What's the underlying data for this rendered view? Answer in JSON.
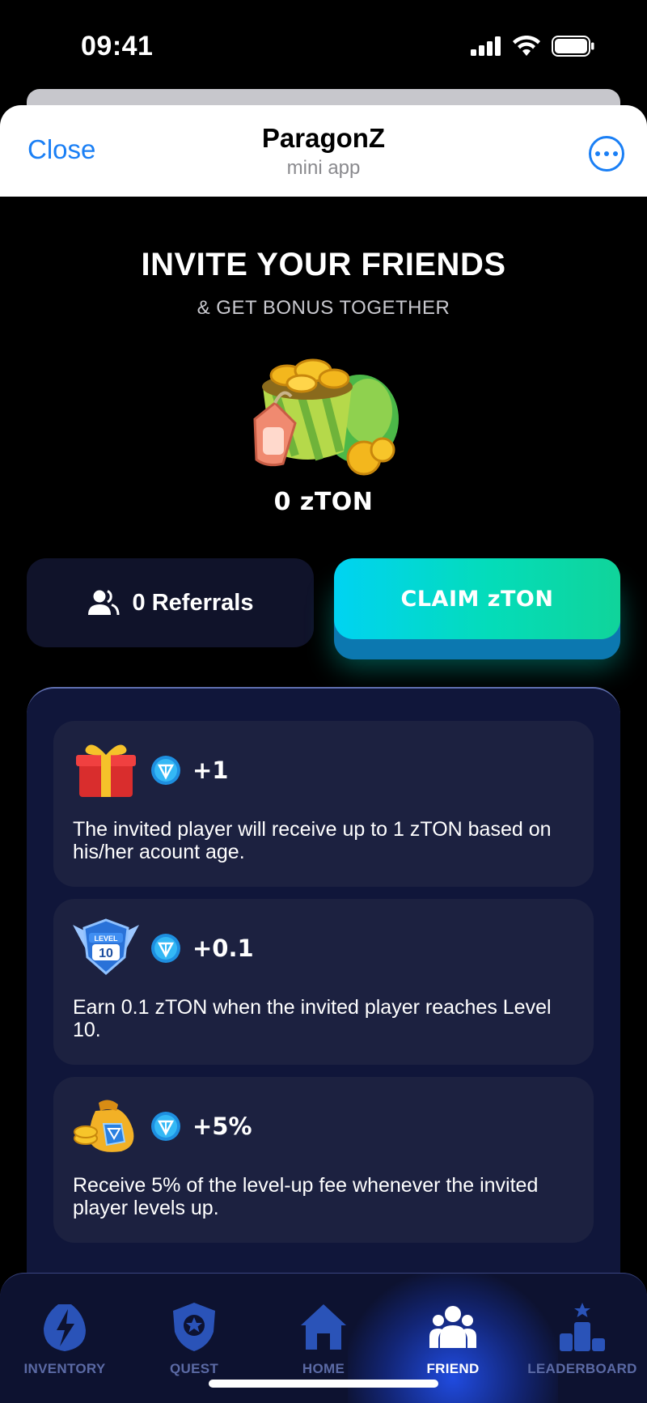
{
  "status_bar": {
    "time": "09:41"
  },
  "header": {
    "close_label": "Close",
    "title": "ParagonZ",
    "subtitle": "mini app"
  },
  "hero": {
    "title": "INVITE YOUR FRIENDS",
    "subtitle": "& GET BONUS TOGETHER",
    "balance": "0 zTON"
  },
  "referrals": {
    "label": "0 Referrals"
  },
  "claim": {
    "label": "CLAIM zTON"
  },
  "bonuses": [
    {
      "icon": "gift-icon",
      "amount": "+1",
      "description": "The invited player will receive up to 1 zTON based on his/her acount age."
    },
    {
      "icon": "level-10-badge-icon",
      "amount": "+0.1",
      "description": "Earn 0.1 zTON when the invited player reaches Level 10."
    },
    {
      "icon": "money-bag-icon",
      "amount": "+5%",
      "description": "Receive 5% of the level-up fee whenever the invited player levels up."
    }
  ],
  "nav": {
    "items": [
      {
        "label": "INVENTORY",
        "icon": "lightning-icon"
      },
      {
        "label": "QUEST",
        "icon": "shield-star-icon"
      },
      {
        "label": "HOME",
        "icon": "home-icon"
      },
      {
        "label": "FRIEND",
        "icon": "friends-icon"
      },
      {
        "label": "LEADERBOARD",
        "icon": "podium-icon"
      }
    ],
    "active": "FRIEND"
  },
  "colors": {
    "accent": "#1a7ff5",
    "claim_gradient_start": "#00d3f2",
    "claim_gradient_end": "#10d49a",
    "nav_inactive": "#5b6aa5",
    "panel": "#10163a",
    "card": "#1c2140"
  }
}
